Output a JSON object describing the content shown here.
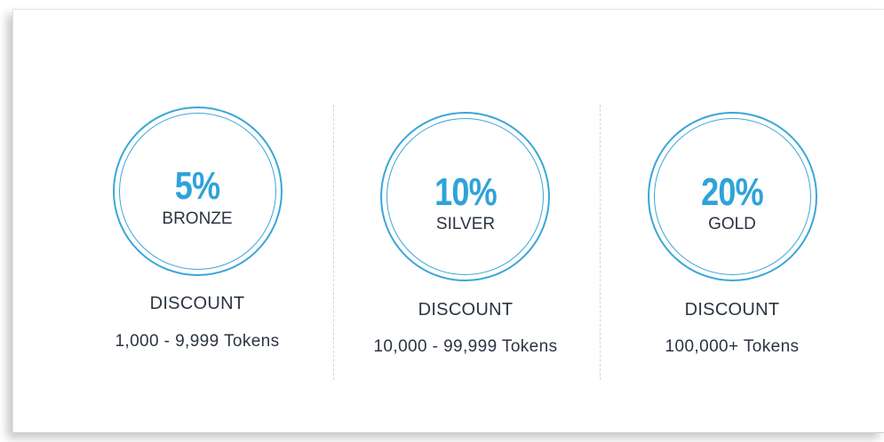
{
  "tiers": [
    {
      "percent": "5%",
      "name": "BRONZE",
      "label": "DISCOUNT",
      "range": "1,000 - 9,999 Tokens"
    },
    {
      "percent": "10%",
      "name": "SILVER",
      "label": "DISCOUNT",
      "range": "10,000 - 99,999 Tokens"
    },
    {
      "percent": "20%",
      "name": "GOLD",
      "label": "DISCOUNT",
      "range": "100,000+ Tokens"
    }
  ],
  "colors": {
    "accent": "#2ea3d9",
    "ring": "#3ba6d8",
    "text": "#2b3442",
    "divider": "#cfd5da"
  }
}
